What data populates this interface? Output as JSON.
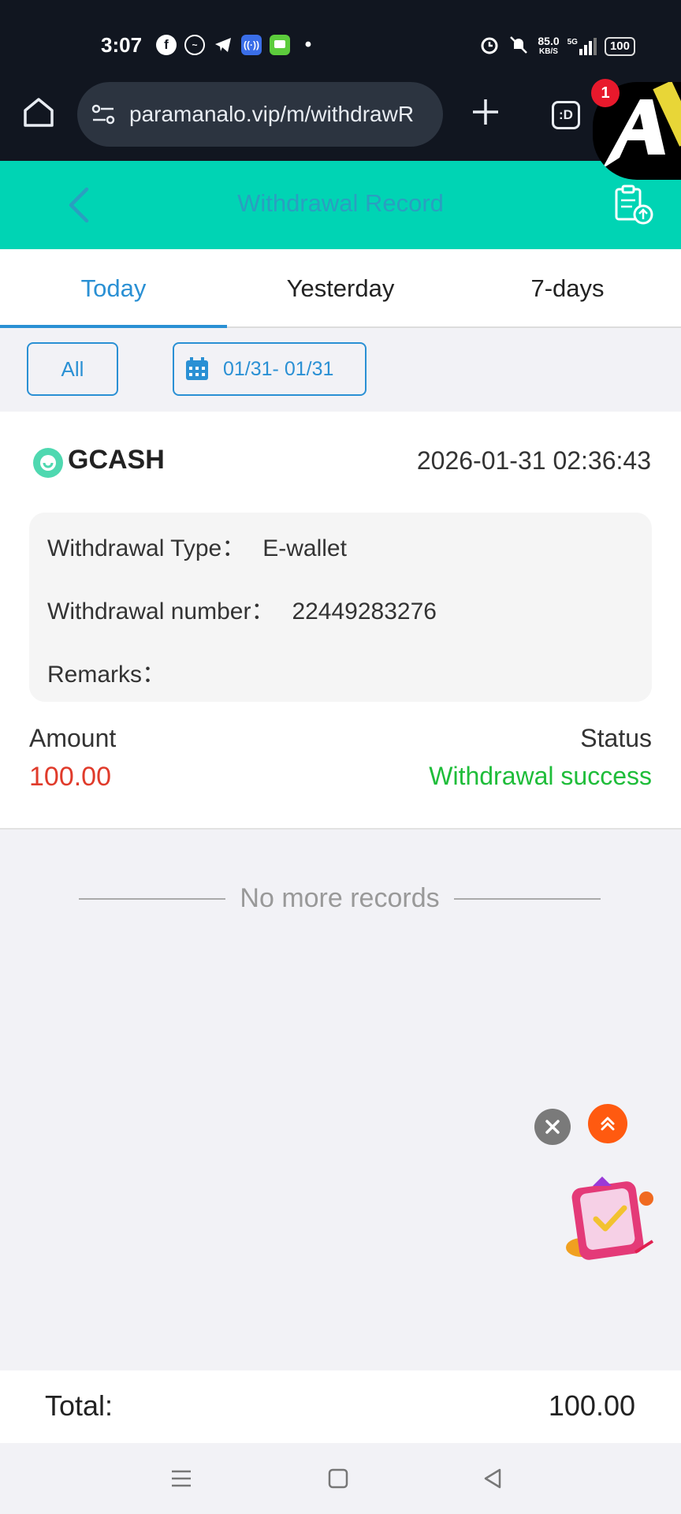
{
  "status_bar": {
    "time": "3:07",
    "net_speed_value": "85.0",
    "net_speed_unit": "KB/S",
    "network": "5G",
    "battery": "100"
  },
  "browser": {
    "url": "paramanalo.vip/m/withdrawR",
    "tabs_label": ":D",
    "tabs_badge": "1"
  },
  "header": {
    "title": "Withdrawal Record"
  },
  "tabs": [
    {
      "label": "Today",
      "active": true
    },
    {
      "label": "Yesterday",
      "active": false
    },
    {
      "label": "7-days",
      "active": false
    }
  ],
  "filters": {
    "type_label": "All",
    "date_range": "01/31- 01/31"
  },
  "record": {
    "method": "GCASH",
    "datetime": "2026-01-31 02:36:43",
    "type_label": "Withdrawal Type：",
    "type_value": "E-wallet",
    "number_label": "Withdrawal number：",
    "number_value": "22449283276",
    "remarks_label": "Remarks：",
    "amount_label": "Amount",
    "amount_value": "100.00",
    "status_label": "Status",
    "status_value": "Withdrawal success"
  },
  "list_end": "No more records",
  "total": {
    "label": "Total:",
    "value": "100.00"
  },
  "colors": {
    "header_bg": "#00d4b4",
    "accent_blue": "#2a90d4",
    "amount_red": "#e03b2b",
    "success_green": "#1fbd3a"
  }
}
